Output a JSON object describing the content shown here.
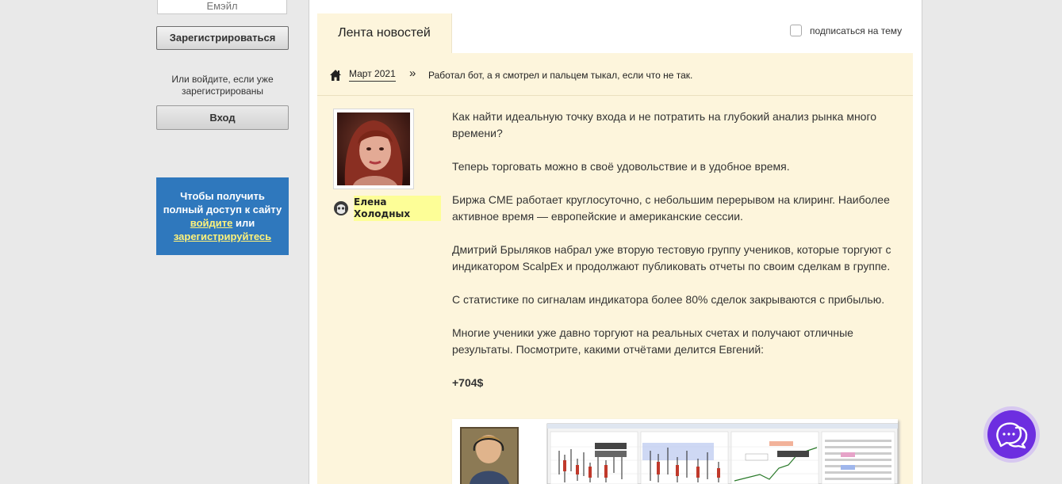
{
  "sidebar": {
    "email_placeholder": "Емэйл",
    "register_button": "Зарегистрироваться",
    "login_note": "Или войдите, если уже зарегистрированы",
    "login_button": "Вход",
    "promo": {
      "text_before": "Чтобы получить полный доступ к сайту ",
      "login_link": "войдите",
      "text_middle": " или ",
      "register_link": "зарегистрируйтесь"
    }
  },
  "main": {
    "tab_label": "Лента новостей",
    "subscribe_label": "подписаться на тему",
    "breadcrumb": {
      "month": "Март 2021",
      "separator": "»",
      "title": "Работал бот, а я смотрел и пальцем тыкал, если что не так."
    },
    "author": {
      "name_line1": "Елена",
      "name_line2": "Холодных"
    },
    "post": {
      "paragraphs": [
        "Как найти идеальную точку входа и не потратить на глубокий анализ рынка много времени?",
        "Теперь торговать можно в своё удовольствие и в удобное время.",
        "Биржа CME работает круглосуточно, с небольшим перерывом на клиринг. Наиболее активное время — европейские и американские сессии.",
        "Дмитрий Брыляков набрал уже вторую тестовую группу учеников, которые торгуют с индикатором ScalpEx и продолжают публиковать отчеты по своим сделкам в группе.",
        "С статистике по сигналам индикатора более 80% сделок закрываются с прибылью.",
        "Многие ученики уже давно торгуют на реальных счетах и получают отличные результаты. Посмотрите, какими отчётами делится Евгений:"
      ],
      "profit": "+704$"
    }
  },
  "colors": {
    "feed_background": "#fdf5dc",
    "promo_background": "#2f78bd",
    "promo_link": "#fff27a",
    "author_highlight": "#fdfe97",
    "chat_button": "#6d2ee0"
  }
}
